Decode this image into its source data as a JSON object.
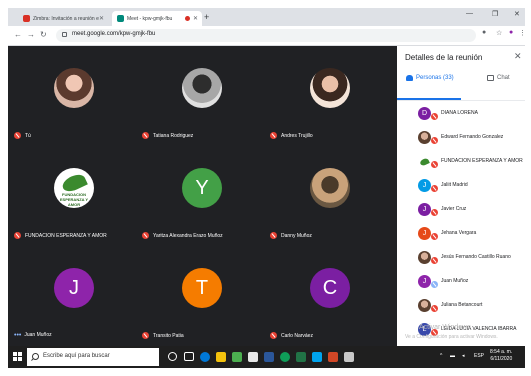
{
  "browser": {
    "tabs": [
      {
        "label": "Zimbra: Invitación a reunión en...",
        "favicon_color": "#d93025",
        "active": false
      },
      {
        "label": "Meet - kpw-gmjk-fbu",
        "favicon_color": "#00897b",
        "active": true
      }
    ],
    "url": "meet.google.com/kpw-gmjk-fbu"
  },
  "grid": {
    "tiles": [
      {
        "name": "Tú",
        "avatar": "photo-a",
        "initial": ""
      },
      {
        "name": "Tatiana Rodriguez",
        "avatar": "photo-b",
        "initial": ""
      },
      {
        "name": "Andres Trujillo",
        "avatar": "photo-c",
        "initial": ""
      },
      {
        "name": "FUNDACION ESPERANZA Y AMOR",
        "avatar": "logo",
        "initial": ""
      },
      {
        "name": "Yaritza Alexandra Erazo Muñoz",
        "avatar": "#43a047",
        "initial": "Y"
      },
      {
        "name": "Danny Muñoz",
        "avatar": "photo-d",
        "initial": ""
      },
      {
        "name": "Juan Muñoz",
        "avatar": "#8e24aa",
        "initial": "J"
      },
      {
        "name": "Transito Patia",
        "avatar": "#f57c00",
        "initial": "T"
      },
      {
        "name": "Carlo Narváez",
        "avatar": "#7b1fa2",
        "initial": "C"
      }
    ],
    "logo_text": "FUNDACION ESPERANZA Y AMOR"
  },
  "panel": {
    "title": "Detalles de la reunión",
    "tab_people": "Personas (33)",
    "tab_chat": "Chat",
    "participants": [
      {
        "name": "DIANA LORENA",
        "initial": "D",
        "color": "#7b1fa2"
      },
      {
        "name": "Edward Fernando Gonzalez",
        "initial": "",
        "color": "photo"
      },
      {
        "name": "FUNDACION ESPERANZA Y AMOR",
        "initial": "",
        "color": "logo"
      },
      {
        "name": "Jaliit Madrid",
        "initial": "J",
        "color": "#039be5"
      },
      {
        "name": "Javier Cruz",
        "initial": "J",
        "color": "#7b1fa2"
      },
      {
        "name": "Jehana Vergara",
        "initial": "J",
        "color": "#e64a19"
      },
      {
        "name": "Jesús Fernando Castillo Ruano",
        "initial": "",
        "color": "photo"
      },
      {
        "name": "Juan Muñoz",
        "initial": "J",
        "color": "#8e24aa"
      },
      {
        "name": "Juliana Betancourt",
        "initial": "",
        "color": "photo"
      },
      {
        "name": "LEIDA LUCIA VALENCIA IBARRA",
        "initial": "L",
        "color": "#3949ab"
      }
    ],
    "watermark_1": "Activar Windows",
    "watermark_2": "Ve a Configuración para activar Windows."
  },
  "taskbar": {
    "search_placeholder": "Escribe aquí para buscar",
    "language": "ESP",
    "time": "8:54 a. m.",
    "date": "6/11/2020"
  }
}
